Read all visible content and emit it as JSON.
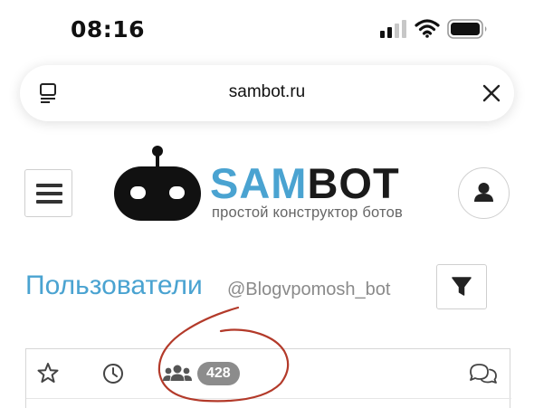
{
  "status_bar": {
    "time": "08:16",
    "icons": [
      "signal-icon",
      "wifi-icon",
      "battery-icon"
    ]
  },
  "browser": {
    "url": "sambot.ru",
    "icons": [
      "reader-icon",
      "close-icon"
    ]
  },
  "header": {
    "logo_sam": "SAM",
    "logo_bot": "BOT",
    "tagline": "простой конструктор ботов",
    "icons": [
      "menu-icon",
      "robot-logo-icon",
      "user-icon"
    ]
  },
  "page": {
    "title": "Пользователи",
    "bot_handle": "@Blogvpomosh_bot",
    "icons": [
      "filter-icon"
    ]
  },
  "tabs": {
    "users_count": "428",
    "icons": [
      "star-icon",
      "clock-icon",
      "users-icon",
      "chat-icon"
    ]
  },
  "colors": {
    "accent": "#4aa3d1",
    "logo_dark": "#1a1a1a",
    "badge": "#8c8c8c",
    "annotation": "#b33a2a"
  }
}
